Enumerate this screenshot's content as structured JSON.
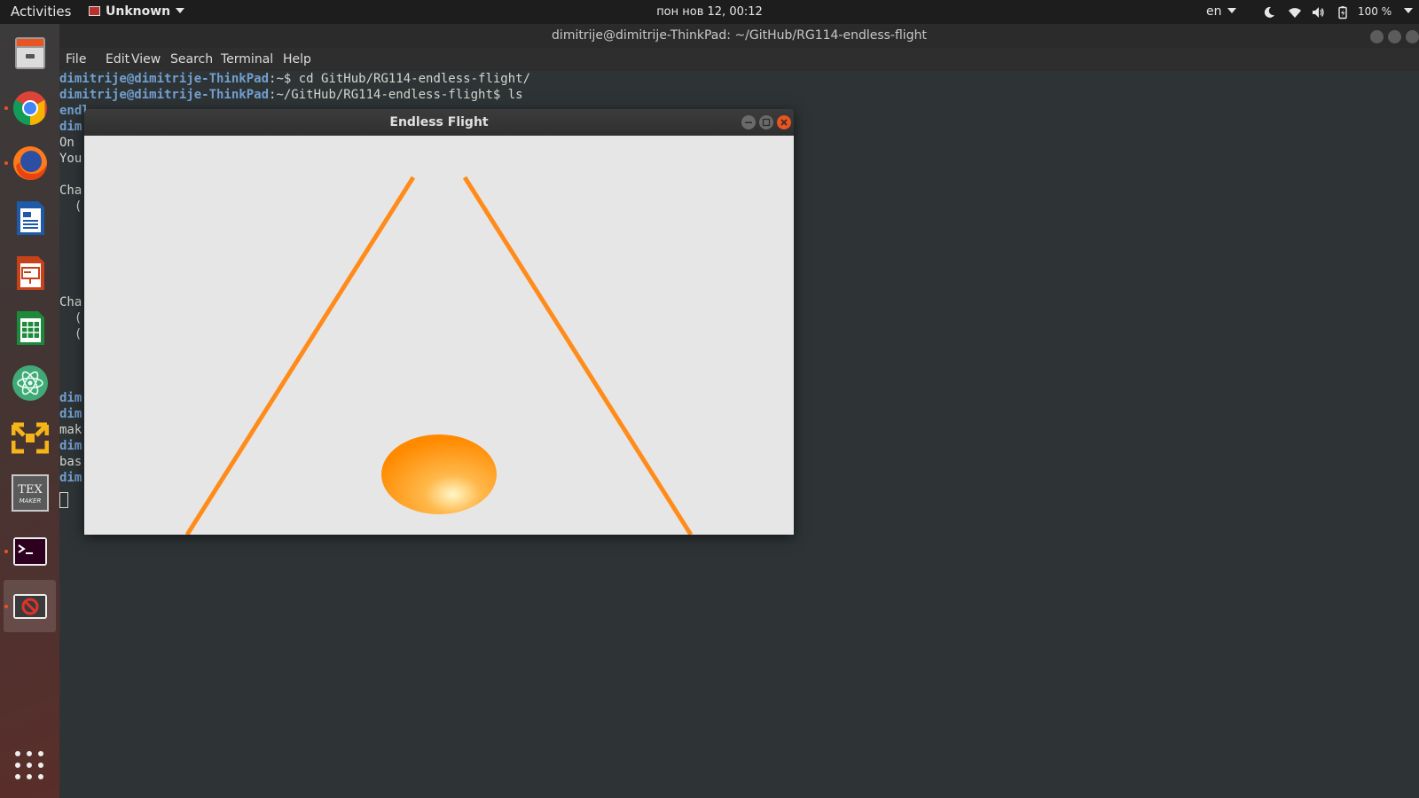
{
  "topbar": {
    "activities": "Activities",
    "app_menu": "Unknown",
    "clock": "пон нов 12, 00:12",
    "language": "en",
    "battery": "100 %"
  },
  "dock": {
    "items": [
      {
        "name": "Files",
        "icon": "file-cabinet-icon"
      },
      {
        "name": "Google Chrome",
        "icon": "chrome-icon"
      },
      {
        "name": "Firefox",
        "icon": "firefox-icon"
      },
      {
        "name": "LibreOffice Writer",
        "icon": "writer-icon"
      },
      {
        "name": "LibreOffice Impress",
        "icon": "impress-icon"
      },
      {
        "name": "LibreOffice Calc",
        "icon": "calc-icon"
      },
      {
        "name": "Atom",
        "icon": "atom-icon"
      },
      {
        "name": "VMware",
        "icon": "vmware-icon"
      },
      {
        "name": "TeXmaker",
        "icon": "texmaker-icon"
      },
      {
        "name": "Terminal",
        "icon": "terminal-icon"
      },
      {
        "name": "Endless Flight",
        "icon": "blocked-app-icon"
      }
    ],
    "tex_label": "TEX",
    "tex_sub": "MAKER"
  },
  "terminal": {
    "title": "dimitrije@dimitrije-ThinkPad: ~/GitHub/RG114-endless-flight",
    "menu": [
      "File",
      "Edit",
      "View",
      "Search",
      "Terminal",
      "Help"
    ],
    "lines": [
      {
        "prompt": "dimitrije@dimitrije-ThinkPad",
        "rest": ":~$ cd GitHub/RG114-endless-flight/"
      },
      {
        "prompt": "dimitrije@dimitrije-ThinkPad",
        "rest": ":~/GitHub/RG114-endless-flight$ ls"
      },
      {
        "prompt": "endl",
        "rest": ""
      },
      {
        "prompt": "dim",
        "rest": ""
      },
      {
        "prompt": "",
        "rest": "On"
      },
      {
        "prompt": "",
        "rest": "You"
      },
      {
        "prompt": "",
        "rest": ""
      },
      {
        "prompt": "",
        "rest": "Cha"
      },
      {
        "prompt": "",
        "rest": "  ("
      },
      {
        "prompt": "",
        "rest": ""
      },
      {
        "prompt": "",
        "rest": ""
      },
      {
        "prompt": "",
        "rest": ""
      },
      {
        "prompt": "",
        "rest": ""
      },
      {
        "prompt": "",
        "rest": ""
      },
      {
        "prompt": "",
        "rest": "Cha"
      },
      {
        "prompt": "",
        "rest": "  ("
      },
      {
        "prompt": "",
        "rest": "  ("
      },
      {
        "prompt": "",
        "rest": ""
      },
      {
        "prompt": "",
        "rest": ""
      },
      {
        "prompt": "",
        "rest": ""
      },
      {
        "prompt": "dim",
        "rest": ""
      },
      {
        "prompt": "dim",
        "rest": ""
      },
      {
        "prompt": "",
        "rest": "mak"
      },
      {
        "prompt": "dim",
        "rest": ""
      },
      {
        "prompt": "",
        "rest": "bas"
      },
      {
        "prompt": "dim",
        "rest": ""
      }
    ]
  },
  "game_window": {
    "title": "Endless Flight",
    "colors": {
      "background": "#e6e6e6",
      "track_line": "#ff8c1a",
      "sphere_base": "#ff8a00",
      "sphere_highlight": "#fff7c8"
    }
  }
}
